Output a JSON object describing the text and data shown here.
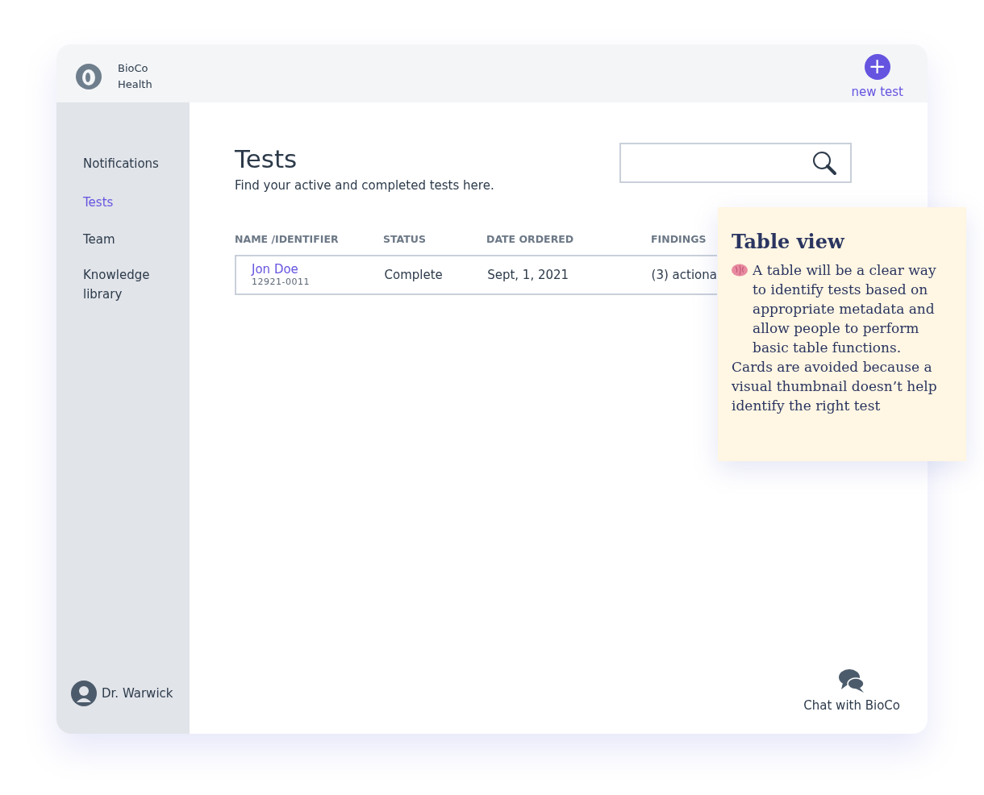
{
  "brand": {
    "line_1": "BioCo",
    "line_2": "Health"
  },
  "new_test": {
    "label": "new test",
    "icon": "+"
  },
  "sidebar": {
    "items": [
      {
        "label": "Notifications",
        "selected": false
      },
      {
        "label": "Tests",
        "selected": true
      },
      {
        "label": "Team",
        "selected": false
      },
      {
        "label": "Knowledge library",
        "selected": false
      }
    ],
    "user": "Dr. Warwick"
  },
  "page": {
    "title": "Tests",
    "subtitle": "Find your active and completed tests here."
  },
  "table": {
    "columns": [
      "NAME /IDENTIFIER",
      "STATUS",
      "DATE ORDERED",
      "FINDINGS"
    ],
    "rows": [
      {
        "name": "Jon Doe",
        "identifier": "12921-0011",
        "status": "Complete",
        "date_ordered": "Sept, 1, 2021",
        "findings": "(3) actiona"
      }
    ]
  },
  "note": {
    "title": "Table view",
    "paragraphs": [
      "A table will be a clear way to identify tests based on appropriate metadata and allow people to perform basic table functions.",
      "Cards are avoided because a visual thumbnail doesn’t help identify the right test"
    ]
  },
  "chat": {
    "label": "Chat with BioCo"
  }
}
